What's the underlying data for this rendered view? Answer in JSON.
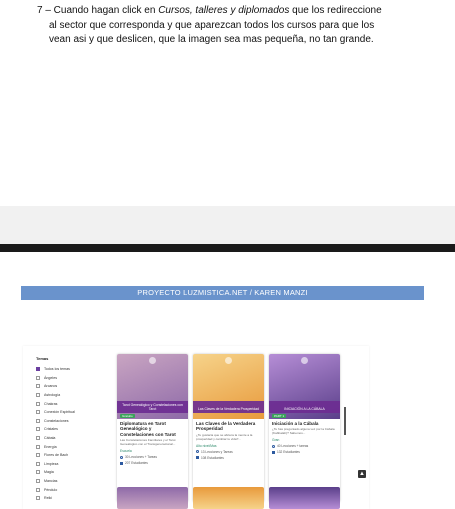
{
  "instruction": {
    "line1_prefix": "7 – Cuando hagan click en ",
    "line1_emph": "Cursos, talleres y diplomados",
    "line1_suffix": " que los redireccione",
    "line2": "al sector que corresponda y que aparezcan todos los cursos para que los",
    "line3": "vean asi y que deslicen, que la imagen sea mas pequeña, no tan grande."
  },
  "banner": "PROYECTO LUZMISTICA.NET / KAREN MANZI",
  "sidebar": {
    "title": "Temas",
    "items": [
      "Todos los temas",
      "Ángeles",
      "Arcanos",
      "Astrología",
      "Chakras",
      "Conexión Espiritual",
      "Constelaciones",
      "Cristales",
      "Cábala",
      "Energía",
      "Flores de Bach",
      "Limpieza",
      "Magia",
      "Mancias",
      "Péndulo",
      "Reiki"
    ]
  },
  "cards": [
    {
      "title": "Diplomatura en Tarot Genealógico y Constelaciones con Tarot",
      "image_text": "Tarot Genealógico y Constelaciones con Tarot",
      "description": "Las Constelaciones Familiares y el Tarot Genealógico con el Transgeneracional...",
      "level": "Escuela",
      "lessons": "30 Lecciones + Tareas",
      "students": "207 Estudiantes",
      "image_badge": "Gratuito",
      "colors": [
        "#8e6aa8",
        "#c9a5c2"
      ]
    },
    {
      "title": "Las Claves de la Verdadera Prosperidad",
      "image_text": "Las Claves de la Verdadera Prosperidad",
      "description": "¿Te gustaría que se abriera la mente a la prosperidad y cambiar tu vida?...",
      "level": "Alto nivel/Mas",
      "lessons": "13 Lecciones y Tareas",
      "students": "108 Estudiantes",
      "image_badge": "",
      "colors": [
        "#e89a3c",
        "#f6d38a"
      ]
    },
    {
      "title": "Iniciación a la Cábala",
      "image_text": "INICIACIÓN A LA CÁBALA",
      "description": "¿Te has preguntado alguna vez por la Cábala (Kabbalah)? Sabemos...",
      "level": "Gran",
      "lessons": "40 Lecciones + tareas",
      "students": "132 Estudiantes",
      "image_badge": "PART 1",
      "colors": [
        "#5a3f8a",
        "#b68ed6"
      ]
    }
  ],
  "scroll_icon": "▲"
}
